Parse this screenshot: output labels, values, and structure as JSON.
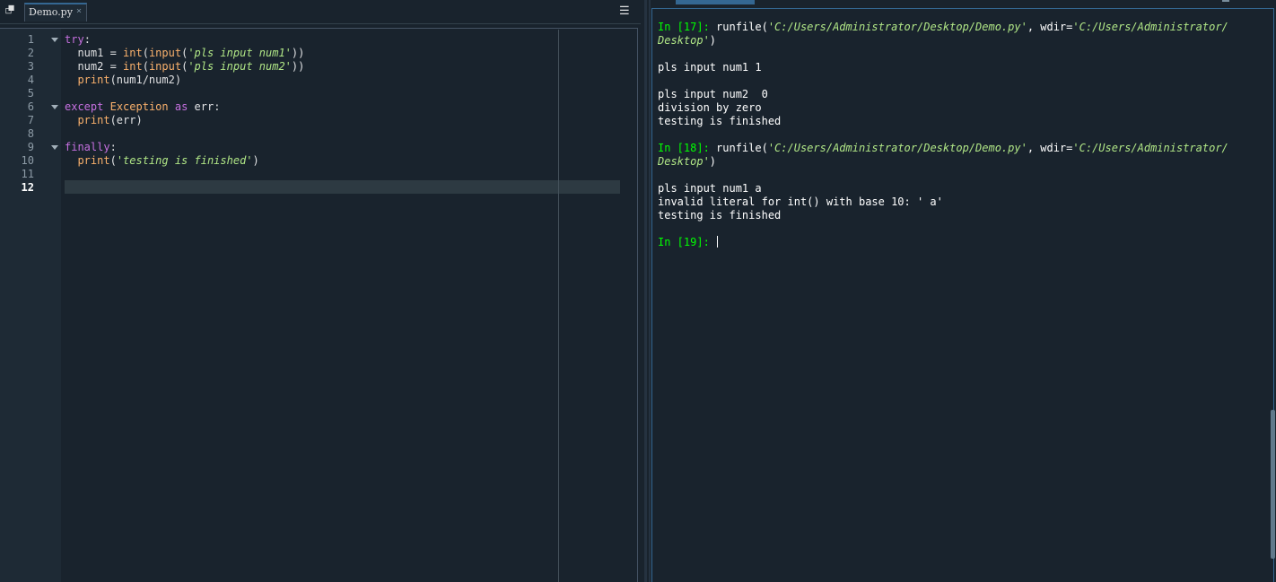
{
  "editor": {
    "tabs": [
      {
        "label": "Demo.py",
        "close": "×"
      }
    ],
    "browse_icon": "browse-tabs-icon",
    "options_icon": "hamburger-menu-icon",
    "line_numbers": [
      "1",
      "2",
      "3",
      "4",
      "5",
      "6",
      "7",
      "8",
      "9",
      "10",
      "11",
      "12"
    ],
    "current_line": "12",
    "code": {
      "l1_kw": "try",
      "l1_colon": ":",
      "l2_a": "  num1 = ",
      "l2_int": "int",
      "l2_b": "(",
      "l2_input": "input",
      "l2_c": "(",
      "l2_str": "'pls input num1'",
      "l2_d": "))",
      "l3_a": "  num2 = ",
      "l3_int": "int",
      "l3_b": "(",
      "l3_input": "input",
      "l3_c": "(",
      "l3_str": "'pls input num2'",
      "l3_d": "))",
      "l4_a": "  ",
      "l4_print": "print",
      "l4_b": "(num1/num2)",
      "l6_except": "except",
      "l6_sp1": " ",
      "l6_exc": "Exception",
      "l6_sp2": " ",
      "l6_as": "as",
      "l6_rest": " err:",
      "l7_a": "  ",
      "l7_print": "print",
      "l7_b": "(err)",
      "l9_kw": "finally",
      "l9_colon": ":",
      "l10_a": "  ",
      "l10_print": "print",
      "l10_b": "(",
      "l10_str": "'testing is finished'",
      "l10_c": ")"
    }
  },
  "console": {
    "p17_prompt": "In [17]: ",
    "p17_cmd": "runfile(",
    "p17_file": "'C:/Users/Administrator/Desktop/Demo.py'",
    "p17_mid": ", wdir=",
    "p17_wdir1": "'C:/Users/Administrator/",
    "p17_wdir2": "Desktop'",
    "p17_close": ")",
    "o17_1": "pls input num1 1",
    "o17_2": "pls input num2  0",
    "o17_3": "division by zero",
    "o17_4": "testing is finished",
    "p18_prompt": "In [18]: ",
    "p18_cmd": "runfile(",
    "p18_file": "'C:/Users/Administrator/Desktop/Demo.py'",
    "p18_mid": ", wdir=",
    "p18_wdir1": "'C:/Users/Administrator/",
    "p18_wdir2": "Desktop'",
    "p18_close": ")",
    "o18_1": "pls input num1 a",
    "o18_2": "invalid literal for int() with base 10: ' a'",
    "o18_3": "testing is finished",
    "p19_prompt": "In [19]: "
  },
  "colors": {
    "background": "#19232d",
    "keyword": "#c670e0",
    "builtin": "#fab16c",
    "string": "#b0e686",
    "prompt": "#00ff00",
    "accent": "#346792"
  }
}
